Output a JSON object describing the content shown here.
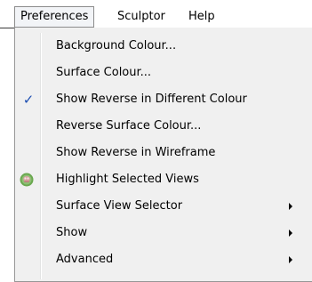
{
  "menubar": {
    "items": [
      {
        "label": "Preferences",
        "active": true
      },
      {
        "label": "Sculptor",
        "active": false
      },
      {
        "label": "Help",
        "active": false
      }
    ]
  },
  "dropdown": {
    "items": [
      {
        "label": "Background Colour...",
        "icon": null,
        "submenu": false
      },
      {
        "label": "Surface Colour...",
        "icon": null,
        "submenu": false
      },
      {
        "label": "Show Reverse in Different Colour",
        "icon": "checkmark-icon",
        "checked": true,
        "submenu": false
      },
      {
        "label": "Reverse Surface Colour...",
        "icon": null,
        "submenu": false
      },
      {
        "label": "Show Reverse in Wireframe",
        "icon": null,
        "submenu": false
      },
      {
        "label": "Highlight Selected Views",
        "icon": "highlight-views-icon",
        "submenu": false
      },
      {
        "label": "Surface View Selector",
        "icon": null,
        "submenu": true
      },
      {
        "label": "Show",
        "icon": null,
        "submenu": true
      },
      {
        "label": "Advanced",
        "icon": null,
        "submenu": true
      }
    ]
  },
  "colors": {
    "menu_background": "#f0f0f0",
    "menubar_active_border": "#8c8c8c",
    "check_color": "#1e4fb2",
    "icon_green": "#6aa84f"
  }
}
